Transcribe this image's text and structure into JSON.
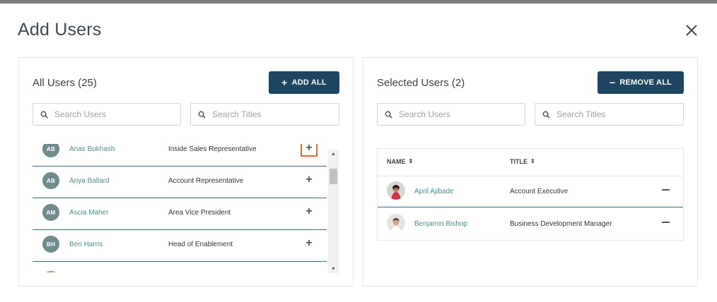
{
  "modal": {
    "title": "Add Users"
  },
  "all_users": {
    "heading": "All Users (25)",
    "add_all_label": "ADD ALL",
    "search_users_placeholder": "Search Users",
    "search_titles_placeholder": "Search Titles",
    "rows": [
      {
        "initials": "AB",
        "name": "Anas Bukhash",
        "title": "Inside Sales Representative"
      },
      {
        "initials": "AB",
        "name": "Anya Ballard",
        "title": "Account Representative"
      },
      {
        "initials": "AM",
        "name": "Ascia Maher",
        "title": "Area Vice President"
      },
      {
        "initials": "BH",
        "name": "Ben Harris",
        "title": "Head of Enablement"
      }
    ]
  },
  "selected_users": {
    "heading": "Selected Users (2)",
    "remove_all_label": "REMOVE ALL",
    "search_users_placeholder": "Search Users",
    "search_titles_placeholder": "Search Titles",
    "columns": {
      "name": "NAME",
      "title": "TITLE"
    },
    "rows": [
      {
        "name": "April Ajibade",
        "title": "Account Executive"
      },
      {
        "name": "Benjamin Bishop",
        "title": "Business Development Manager"
      }
    ]
  },
  "colors": {
    "primary_button": "#1e4562",
    "link": "#4f8c8d",
    "row_divider": "#2f6e74",
    "focus_outline": "#e86b35",
    "avatar": "#6f8b8c"
  },
  "icons": {
    "close": "close-icon",
    "add": "plus-icon",
    "remove": "minus-icon",
    "search": "search-icon",
    "sort": "sort-icon"
  }
}
